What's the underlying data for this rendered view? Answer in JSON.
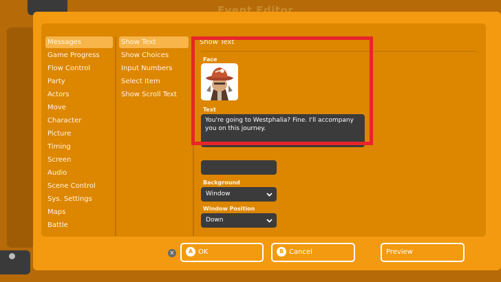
{
  "window": {
    "title": "Event Editor"
  },
  "categories": {
    "items": [
      {
        "label": "Messages",
        "selected": true
      },
      {
        "label": "Game Progress"
      },
      {
        "label": "Flow Control"
      },
      {
        "label": "Party"
      },
      {
        "label": "Actors"
      },
      {
        "label": "Move"
      },
      {
        "label": "Character"
      },
      {
        "label": "Picture"
      },
      {
        "label": "Timing"
      },
      {
        "label": "Screen"
      },
      {
        "label": "Audio"
      },
      {
        "label": "Scene Control"
      },
      {
        "label": "Sys. Settings"
      },
      {
        "label": "Maps"
      },
      {
        "label": "Battle"
      }
    ]
  },
  "commands": {
    "items": [
      {
        "label": "Show Text",
        "selected": true
      },
      {
        "label": "Show Choices"
      },
      {
        "label": "Input Numbers"
      },
      {
        "label": "Select Item"
      },
      {
        "label": "Show Scroll Text"
      }
    ]
  },
  "detail": {
    "header": "Show Text",
    "face_label": "Face",
    "text_label": "Text",
    "text_value": "You're going to Westphalia? Fine. I'll accompany you on this journey.",
    "name_value": "",
    "background_label": "Background",
    "background_value": "Window",
    "position_label": "Window Position",
    "position_value": "Down"
  },
  "footer": {
    "close_glyph": "X",
    "ok_glyph": "A",
    "ok_label": "OK",
    "cancel_glyph": "B",
    "cancel_label": "Cancel",
    "preview_label": "Preview"
  },
  "colors": {
    "accent": "#f39a10",
    "panel": "#dd8600",
    "selection": "#f7b54a",
    "highlight": "#e8252a",
    "field": "#3b3b3b"
  }
}
